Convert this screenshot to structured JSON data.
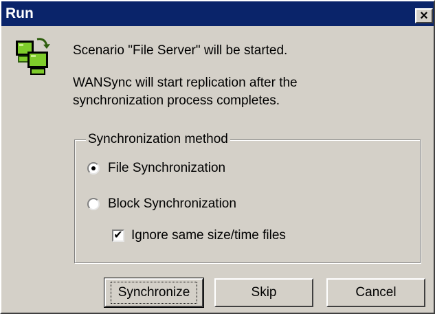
{
  "window": {
    "title": "Run",
    "close_glyph": "×"
  },
  "icons": {
    "app": "replication-computers-icon",
    "close": "close-icon"
  },
  "message": {
    "line1": "Scenario \"File Server\" will be started.",
    "line2": "WANSync will start replication after the synchronization process completes."
  },
  "sync_method": {
    "title": "Synchronization method",
    "options": [
      {
        "label": "File Synchronization",
        "selected": true
      },
      {
        "label": "Block Synchronization",
        "selected": false
      }
    ],
    "ignore_same": {
      "label": "Ignore same size/time files",
      "checked": true
    }
  },
  "buttons": {
    "synchronize": "Synchronize",
    "skip": "Skip",
    "cancel": "Cancel"
  },
  "colors": {
    "titlebar": "#0a246a",
    "dialog_bg": "#d4d0c8",
    "icon_green": "#7ecb2b"
  }
}
